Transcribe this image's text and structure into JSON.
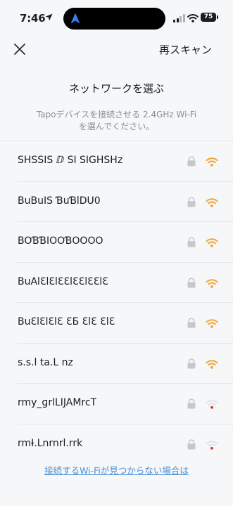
{
  "status_bar": {
    "time": "7:46",
    "battery": "75"
  },
  "nav": {
    "rescan_label": "再スキャン"
  },
  "header": {
    "title": "ネットワークを選ぶ",
    "subtitle_line1": "Tapoデバイスを接続させる 2.4GHz Wi-Fi",
    "subtitle_line2": "を選んでください。"
  },
  "networks": [
    {
      "ssid": "SHSSIS ⅅ SI SIGHSHz",
      "secured": true,
      "signal": "strong",
      "signal_color": "#f0a534"
    },
    {
      "ssid": "BuBuIS ƁuƁlDU0",
      "secured": true,
      "signal": "strong",
      "signal_color": "#f0a534"
    },
    {
      "ssid": "BOƁƁIOOƁOOOO",
      "secured": true,
      "signal": "strong",
      "signal_color": "#f0a534"
    },
    {
      "ssid": "BuAlƐlƐlƐƐlƐƐlƐƐlƐ",
      "secured": true,
      "signal": "strong",
      "signal_color": "#f0a534"
    },
    {
      "ssid": "BuƐlƐlƐlƐ ƐƂ ƐlƐ ƐlƐ",
      "secured": true,
      "signal": "strong",
      "signal_color": "#f0a534"
    },
    {
      "ssid": "s.s.l  ta.L   nz",
      "secured": true,
      "signal": "strong",
      "signal_color": "#f0a534"
    },
    {
      "ssid": "rmy_ɡrlLIJAMrcT",
      "secured": true,
      "signal": "weak",
      "signal_color": "#d9302c"
    },
    {
      "ssid": "rmƗ.Lnrnrl.rrk",
      "secured": true,
      "signal": "weak",
      "signal_color": "#d9302c"
    }
  ],
  "footer": {
    "help_link": "接続するWi-Fiが見つからない場合は"
  },
  "colors": {
    "accent_link": "#4a8fd6",
    "wifi_strong": "#f0a534",
    "wifi_weak": "#d9302c",
    "lock_gray": "#c7c7cc"
  }
}
